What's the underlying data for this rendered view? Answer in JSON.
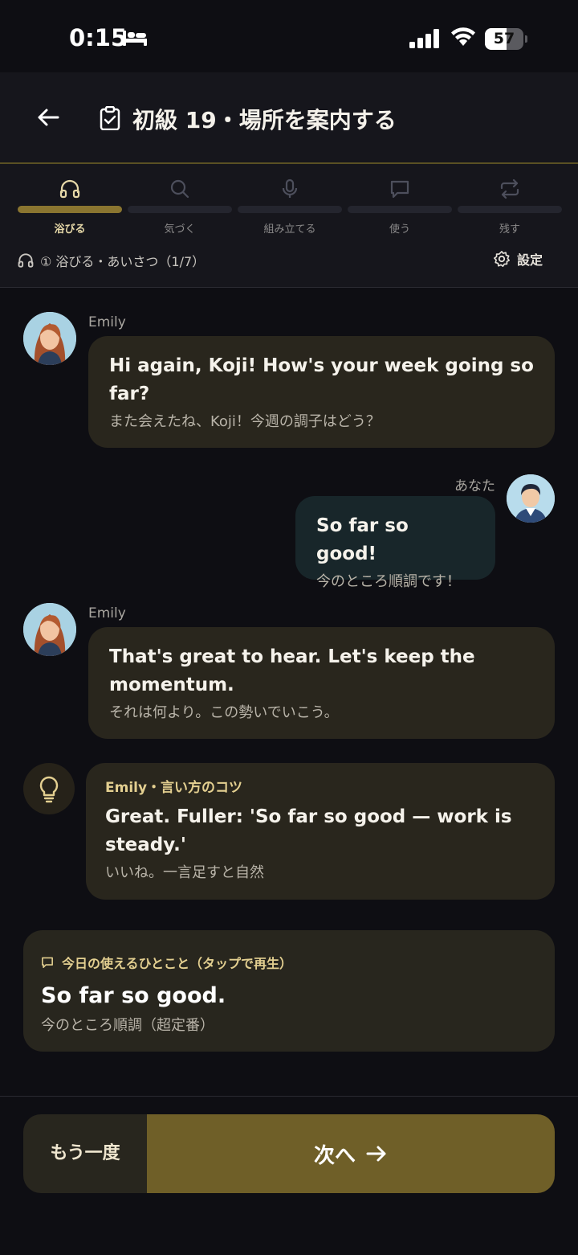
{
  "status": {
    "time": "0:15",
    "battery": "57",
    "battery_level": 0.57
  },
  "header": {
    "title": "初級 19・場所を案内する"
  },
  "steps": [
    {
      "label": "浴びる",
      "icon": "headphones-icon",
      "active": true
    },
    {
      "label": "気づく",
      "icon": "search-icon",
      "active": false
    },
    {
      "label": "組み立てる",
      "icon": "mic-icon",
      "active": false
    },
    {
      "label": "使う",
      "icon": "chat-icon",
      "active": false
    },
    {
      "label": "残す",
      "icon": "repeat-icon",
      "active": false
    }
  ],
  "progress": {
    "text": "① 浴びる・あいさつ（1/7）",
    "settings_label": "設定"
  },
  "messages": [
    {
      "speaker": "Emily",
      "en": "Hi again, Koji! How's your week going so far?",
      "ja": "また会えたね、Koji！今週の調子はどう？"
    },
    {
      "speaker": "あなた",
      "en": "So far so good!",
      "ja": "今のところ順調です！"
    },
    {
      "speaker": "Emily",
      "en": "That's great to hear. Let's keep the momentum.",
      "ja": "それは何より。この勢いでいこう。"
    }
  ],
  "tip": {
    "heading": "Emily・言い方のコツ",
    "en": "Great. Fuller: 'So far so good — work is steady.'",
    "ja": "いいね。一言足すと自然"
  },
  "phrase": {
    "heading": "今日の使えるひとこと（タップで再生）",
    "en": "So far so good.",
    "ja": "今のところ順調（超定番）"
  },
  "footer": {
    "again_label": "もう一度",
    "next_label": "次へ"
  },
  "colors": {
    "accent": "#8a7530",
    "bubble": "#29261d",
    "my_bubble": "#18262a",
    "next_button": "#6f5f28"
  }
}
